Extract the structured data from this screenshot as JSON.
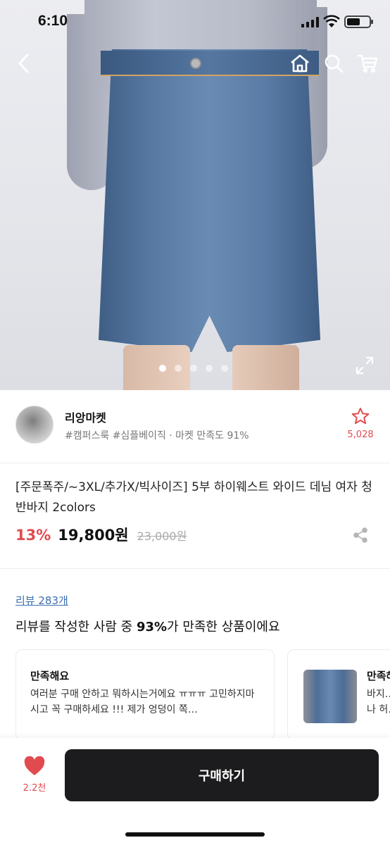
{
  "status_bar": {
    "time": "6:10"
  },
  "hero": {
    "image_count": 5,
    "active_index": 0
  },
  "seller": {
    "name": "리앙마켓",
    "meta": "#캠퍼스룩 #심플베이직 · 마켓 만족도 91%",
    "favorite_count": "5,028"
  },
  "product": {
    "title": "[주문폭주/~3XL/추가X/빅사이즈] 5부 하이웨스트 와이드 데님 여자 청 반바지 2colors",
    "discount": "13%",
    "price": "19,800원",
    "original_price": "23,000원"
  },
  "reviews": {
    "link_label": "리뷰 283개",
    "summary_prefix": "리뷰를 작성한 사람 중 ",
    "summary_percent": "93%",
    "summary_suffix": "가 만족한 상품이에요",
    "cards": [
      {
        "head": "만족해요",
        "body": "여러분 구매 안하고 뭐하시는거에요 ㅠㅠㅠ 고민하지마시고 꼭 구매하세요 !!! 제가 엉덩이 쪽…"
      },
      {
        "head": "만족해요",
        "body_line1": "바지…",
        "body_line2": "나 허…"
      }
    ]
  },
  "bottom_bar": {
    "like_count": "2.2천",
    "buy_label": "구매하기"
  },
  "colors": {
    "accent_red": "#e14b50",
    "link_blue": "#3c6fb0",
    "buy_bg": "#1c1c1e"
  },
  "icons": [
    "back-icon",
    "home-icon",
    "search-icon",
    "cart-icon",
    "expand-icon",
    "star-icon",
    "share-icon",
    "heart-icon"
  ]
}
